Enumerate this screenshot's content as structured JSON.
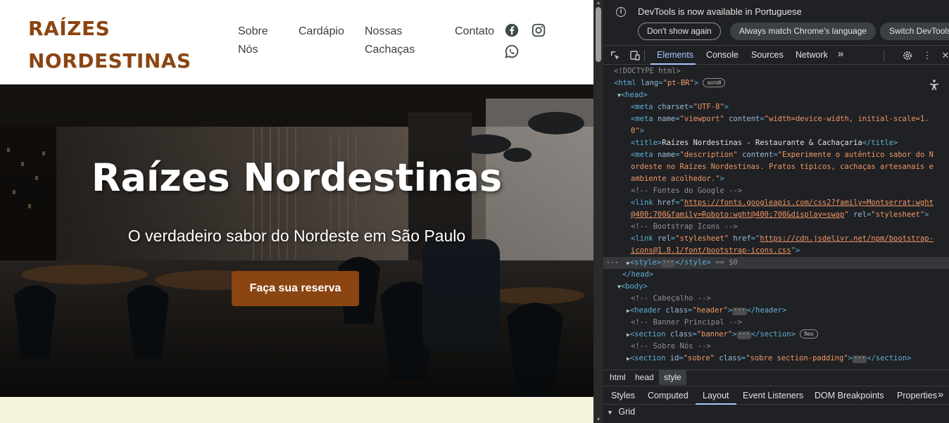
{
  "site": {
    "logo_line1": "RAÍZES",
    "logo_line2": "NORDESTINAS",
    "nav": {
      "sobre_line1": "Sobre",
      "sobre_line2": "Nós",
      "cardapio": "Cardápio",
      "nossas_line1": "Nossas",
      "nossas_line2": "Cachaças",
      "contato": "Contato"
    },
    "social_icons": [
      "facebook-icon",
      "instagram-icon",
      "whatsapp-icon"
    ],
    "banner": {
      "title": "Raízes Nordestinas",
      "subtitle": "O verdadeiro sabor do Nordeste em São Paulo",
      "cta_label": "Faça sua reserva"
    },
    "colors": {
      "brand": "#8b4513",
      "nav_text": "#3d3d3d",
      "strip": "#f6f3dc"
    }
  },
  "devtools": {
    "infobar": {
      "message": "DevTools is now available in Portuguese",
      "btn_dont_show": "Don't show again",
      "btn_match": "Always match Chrome's language",
      "btn_switch": "Switch DevTools"
    },
    "tabs": {
      "elements": "Elements",
      "console": "Console",
      "sources": "Sources",
      "network": "Network",
      "more": "»"
    },
    "dom": {
      "l1": "<!DOCTYPE html>",
      "l2_tag_open": "<html",
      "l2_attr": "lang",
      "l2_val": "\"pt-BR\"",
      "l2_close": ">",
      "l2_badge": "scroll",
      "l3": "<head>",
      "l4_tag": "<meta",
      "l4_attr": "charset",
      "l4_val": "\"UTF-8\"",
      "l4_close": ">",
      "l5_tag": "<meta",
      "l5_attr1": "name",
      "l5_val1": "\"viewport\"",
      "l5_attr2": "content",
      "l5_val2": "\"width=device-width, initial-scale=1.",
      "l6_val": "0\"",
      "l6_close": ">",
      "l7_open": "<title>",
      "l7_text": "Raízes Nordestinas - Restaurante & Cachaçaria",
      "l7_close": "</title>",
      "l8_tag": "<meta",
      "l8_attr1": "name",
      "l8_val1": "\"description\"",
      "l8_attr2": "content",
      "l8_val2": "\"Experimente o autêntico sabor do N",
      "l9_val": "ordeste no Raízes Nordestinas. Pratos típicos, cachaças artesanais e",
      "l10_val": "ambiente acolhedor.\"",
      "l10_close": ">",
      "l11": "<!-- Fontes do Google -->",
      "l12_tag": "<link",
      "l12_attr": "href",
      "l12_val": "https://fonts.googleapis.com/css2?family=Montserrat:wght",
      "l13_val": "@400;700&family=Roboto:wght@400;700&display=swap",
      "l13_attr": "rel",
      "l13_val2": "\"stylesheet\"",
      "l13_close": ">",
      "l14": "<!-- Bootstrap Icons -->",
      "l15_tag": "<link",
      "l15_attr1": "rel",
      "l15_val1": "\"stylesheet\"",
      "l15_attr2": "href",
      "l15_val2": "https://cdn.jsdelivr.net/npm/bootstrap-",
      "l16_val": "icons@1.8.1/font/bootstrap-icons.css",
      "l16_close": "\">",
      "l17_open": "<style>",
      "l17_close": "</style>",
      "l17_eq": "== $0",
      "l18": "</head>",
      "l19": "<body>",
      "l20": "<!-- Cabeçalho -->",
      "l21_tag": "<header",
      "l21_attr": "class",
      "l21_val": "\"header\"",
      "l21_close": "</header>",
      "l22": "<!-- Banner Principal -->",
      "l23_tag": "<section",
      "l23_attr": "class",
      "l23_val": "\"banner\"",
      "l23_close": "</section>",
      "l23_badge": "flex",
      "l24": "<!-- Sobre Nós -->",
      "l25_tag": "<section",
      "l25_attr1": "id",
      "l25_val1": "\"sobre\"",
      "l25_attr2": "class",
      "l25_val2": "\"sobre section-padding\"",
      "l25_close": "</section>"
    },
    "breadcrumb": [
      "html",
      "head",
      "style"
    ],
    "subtabs": {
      "styles": "Styles",
      "computed": "Computed",
      "layout": "Layout",
      "listeners": "Event Listeners",
      "dom_breakpoints": "DOM Breakpoints",
      "properties": "Properties",
      "more": "»"
    },
    "grid_label": "Grid",
    "colors": {
      "background": "#202124",
      "accent": "#a8c7fa",
      "tag": "#5db0d7",
      "attr_value": "#f29766"
    }
  }
}
